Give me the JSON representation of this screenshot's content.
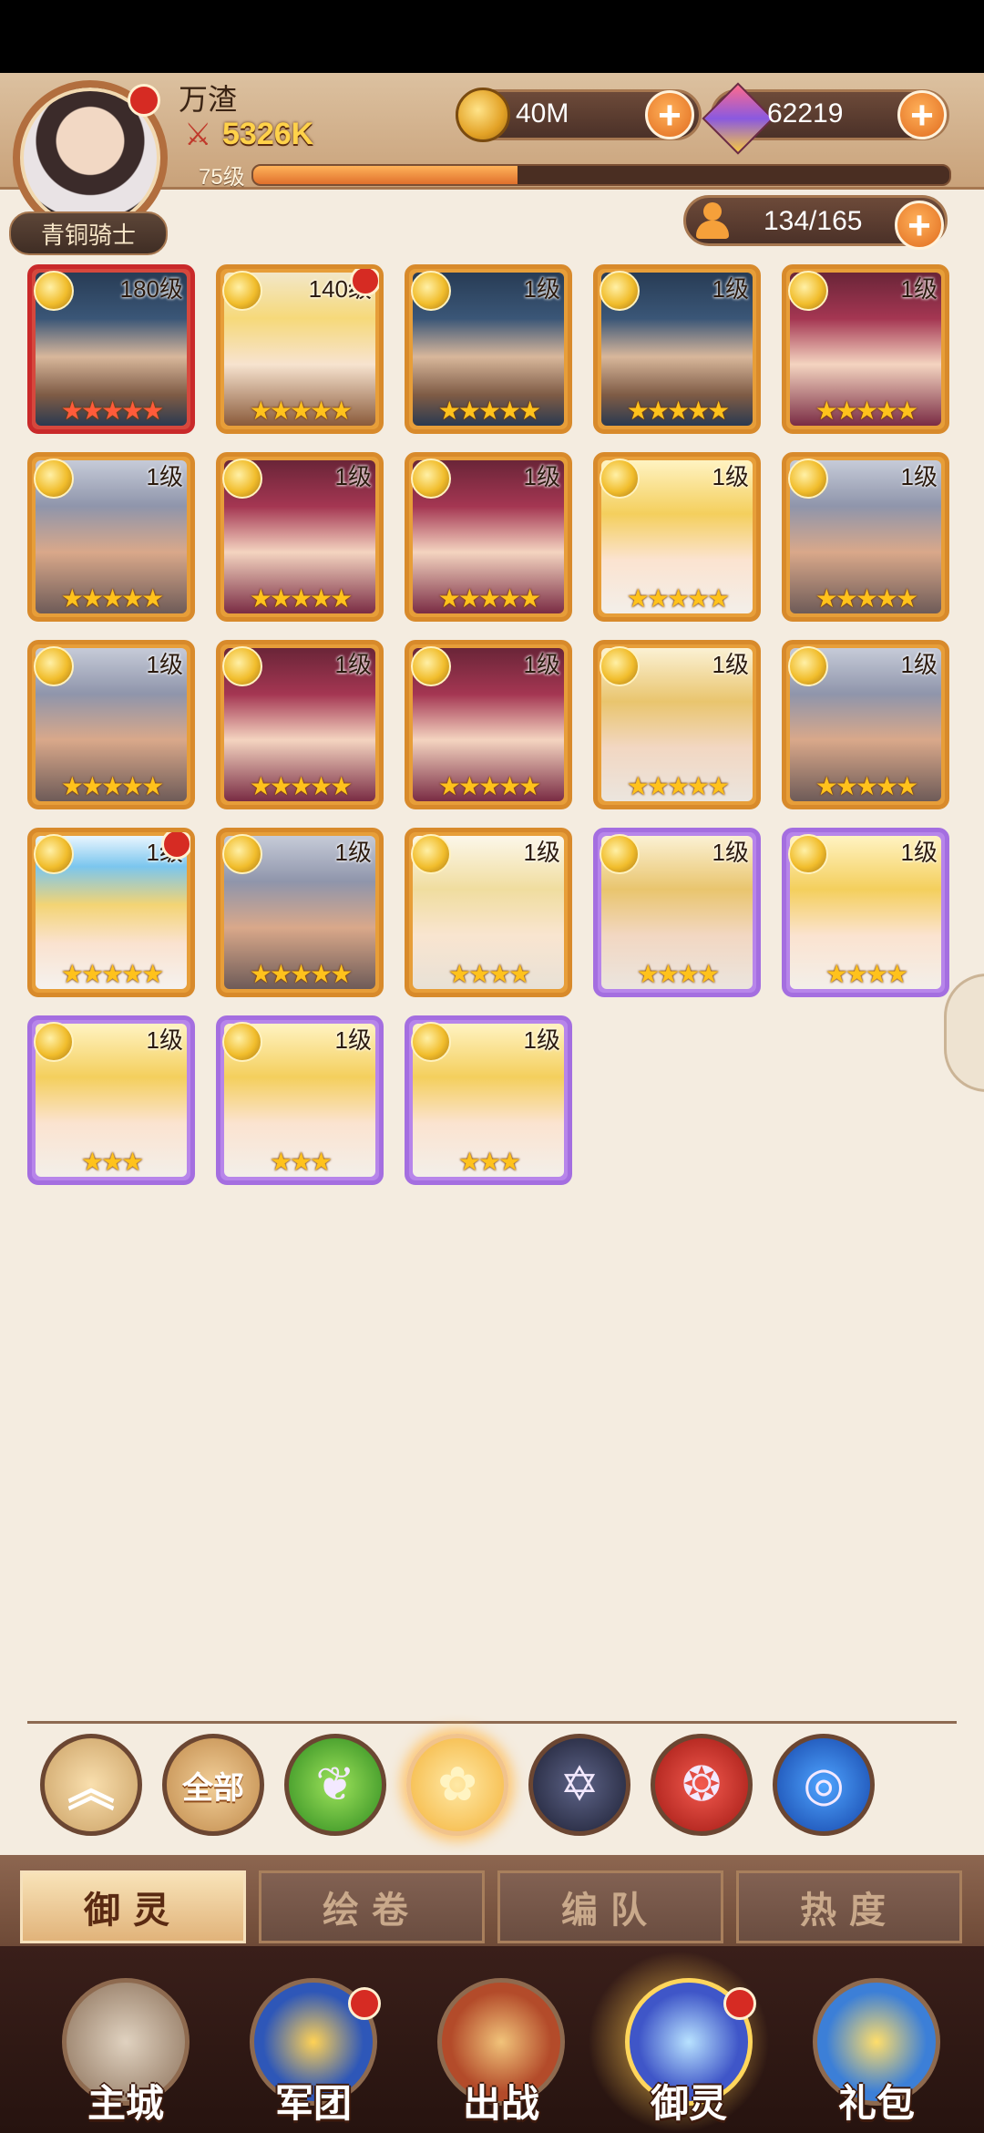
{
  "player": {
    "name": "万渣",
    "power": "5326K",
    "level": "75级",
    "exp_fraction": 0.38,
    "rank": "青铜骑士"
  },
  "resources": {
    "gold": "40M",
    "gems": "62219",
    "population": "134/165"
  },
  "heroes": [
    {
      "level": "180级",
      "stars": "★★★★★",
      "style": "warrior",
      "frame": "red",
      "dot": false
    },
    {
      "level": "140级",
      "stars": "★★★★★",
      "style": "elf",
      "frame": "orange",
      "dot": true
    },
    {
      "level": "1级",
      "stars": "★★★★★",
      "style": "warrior",
      "frame": "orange",
      "dot": false
    },
    {
      "level": "1级",
      "stars": "★★★★★",
      "style": "warrior",
      "frame": "orange",
      "dot": false
    },
    {
      "level": "1级",
      "stars": "★★★★★",
      "style": "crimson",
      "frame": "orange",
      "dot": false
    },
    {
      "level": "1级",
      "stars": "★★★★★",
      "style": "silver",
      "frame": "orange",
      "dot": false
    },
    {
      "level": "1级",
      "stars": "★★★★★",
      "style": "crimson",
      "frame": "orange",
      "dot": false
    },
    {
      "level": "1级",
      "stars": "★★★★★",
      "style": "crimson",
      "frame": "orange",
      "dot": false
    },
    {
      "level": "1级",
      "stars": "★★★★★",
      "style": "blonde",
      "frame": "orange",
      "dot": false
    },
    {
      "level": "1级",
      "stars": "★★★★★",
      "style": "silver",
      "frame": "orange",
      "dot": false
    },
    {
      "level": "1级",
      "stars": "★★★★★",
      "style": "silver",
      "frame": "orange",
      "dot": false
    },
    {
      "level": "1级",
      "stars": "★★★★★",
      "style": "crimson",
      "frame": "orange",
      "dot": false
    },
    {
      "level": "1级",
      "stars": "★★★★★",
      "style": "crimson",
      "frame": "orange",
      "dot": false
    },
    {
      "level": "1级",
      "stars": "★★★★★",
      "style": "goldman",
      "frame": "orange",
      "dot": false
    },
    {
      "level": "1级",
      "stars": "★★★★★",
      "style": "silver",
      "frame": "orange",
      "dot": false
    },
    {
      "level": "1级",
      "stars": "★★★★★",
      "style": "queen",
      "frame": "orange",
      "dot": true
    },
    {
      "level": "1级",
      "stars": "★★★★★",
      "style": "silver",
      "frame": "orange",
      "dot": false
    },
    {
      "level": "1级",
      "stars": "★★★★",
      "style": "king",
      "frame": "orange",
      "dot": false
    },
    {
      "level": "1级",
      "stars": "★★★★",
      "style": "goldman",
      "frame": "purple",
      "dot": false
    },
    {
      "level": "1级",
      "stars": "★★★★",
      "style": "blonde",
      "frame": "purple",
      "dot": false
    },
    {
      "level": "1级",
      "stars": "★★★",
      "style": "blonde",
      "frame": "purple",
      "dot": false
    },
    {
      "level": "1级",
      "stars": "★★★",
      "style": "blonde",
      "frame": "purple",
      "dot": false
    },
    {
      "level": "1级",
      "stars": "★★★",
      "style": "blonde",
      "frame": "purple",
      "dot": false
    }
  ],
  "filters": [
    {
      "name": "collapse",
      "label": "",
      "icon": "double-chevron-up-icon",
      "glyph": "︽",
      "cls": "f-up"
    },
    {
      "name": "all",
      "label": "全部",
      "icon": "",
      "glyph": "",
      "cls": "f-all"
    },
    {
      "name": "nature",
      "label": "",
      "icon": "leaf-icon",
      "glyph": "❦",
      "cls": "f-nature"
    },
    {
      "name": "light",
      "label": "",
      "icon": "rose-icon",
      "glyph": "✿",
      "cls": "f-light"
    },
    {
      "name": "dark",
      "label": "",
      "icon": "hexagram-icon",
      "glyph": "✡",
      "cls": "f-dark"
    },
    {
      "name": "fire",
      "label": "",
      "icon": "phoenix-icon",
      "glyph": "❂",
      "cls": "f-fire"
    },
    {
      "name": "water",
      "label": "",
      "icon": "wave-icon",
      "glyph": "◎",
      "cls": "f-water"
    }
  ],
  "subtabs": [
    "御灵",
    "绘卷",
    "编队",
    "热度"
  ],
  "nav": [
    {
      "label": "主城",
      "icon": "castle-icon",
      "cls": "ni-city",
      "dot": false
    },
    {
      "label": "军团",
      "icon": "fist-shield-icon",
      "cls": "ni-legion",
      "dot": true
    },
    {
      "label": "出战",
      "icon": "sword-gate-icon",
      "cls": "ni-battle",
      "dot": false
    },
    {
      "label": "御灵",
      "icon": "crystal-icon",
      "cls": "ni-spirit",
      "dot": true
    },
    {
      "label": "礼包",
      "icon": "shop-stall-icon",
      "cls": "ni-gift",
      "dot": false
    }
  ]
}
